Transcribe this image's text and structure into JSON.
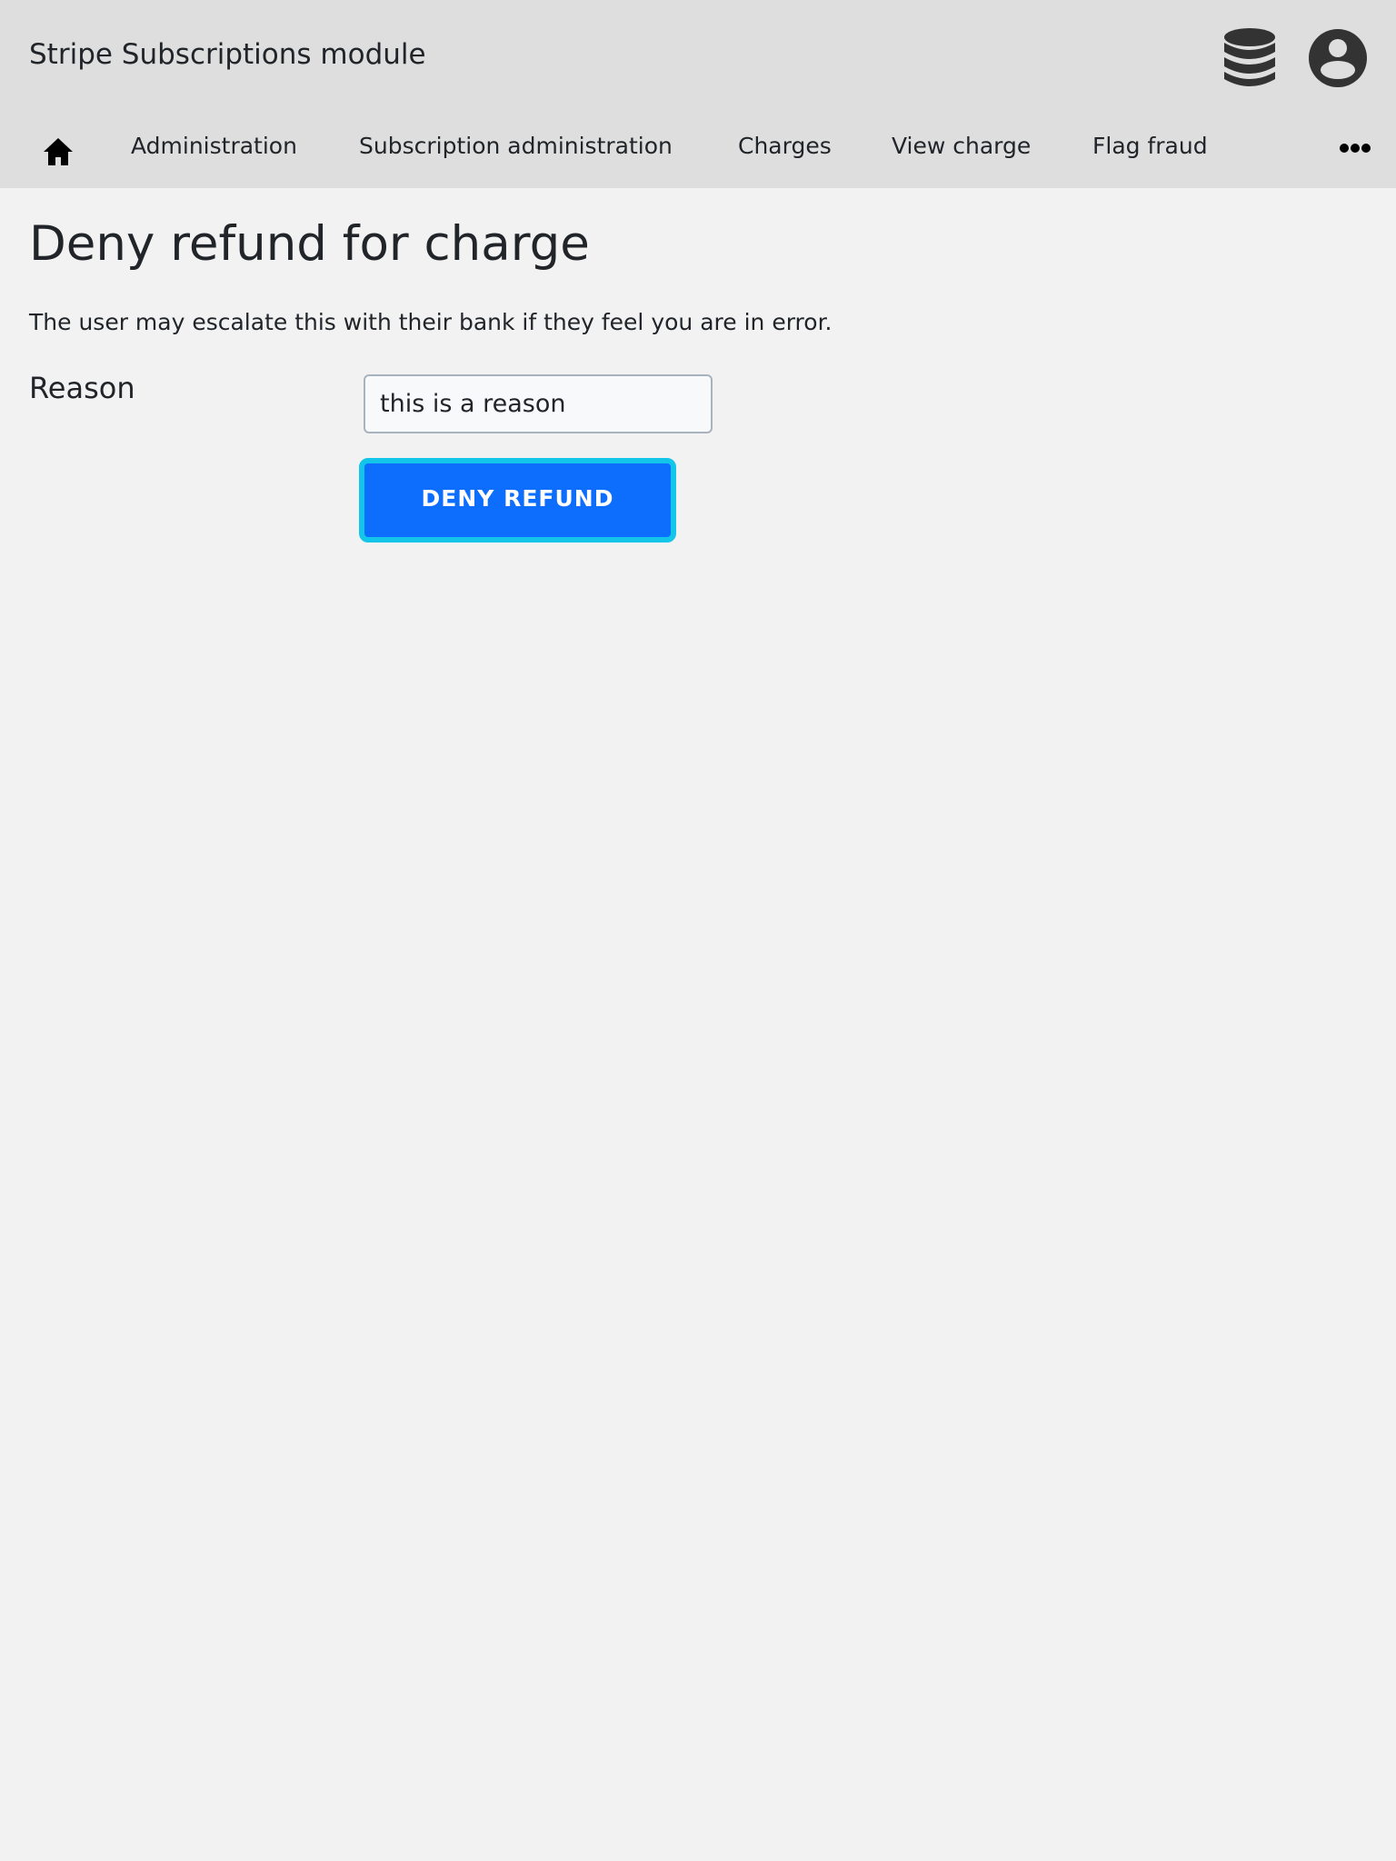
{
  "app": {
    "title": "Stripe Subscriptions module"
  },
  "header": {
    "icons": {
      "database": "database-icon",
      "account": "user-circle-icon"
    }
  },
  "nav": {
    "home_icon": "home-icon",
    "items": [
      {
        "label": "Administration"
      },
      {
        "label": "Subscription administration"
      },
      {
        "label": "Charges"
      },
      {
        "label": "View charge"
      },
      {
        "label": "Flag fraud"
      }
    ],
    "more_icon": "ellipsis-icon"
  },
  "main": {
    "heading": "Deny refund for charge",
    "intro": "The user may escalate this with their bank if they feel you are in error.",
    "form": {
      "reason_label": "Reason",
      "reason_value": "this is a reason",
      "submit_label": "DENY REFUND"
    }
  },
  "colors": {
    "topbar": "#dedede",
    "background": "#f2f2f2",
    "primary": "#0d6efd",
    "focus_ring": "#13c5e9",
    "icon": "#333333"
  }
}
